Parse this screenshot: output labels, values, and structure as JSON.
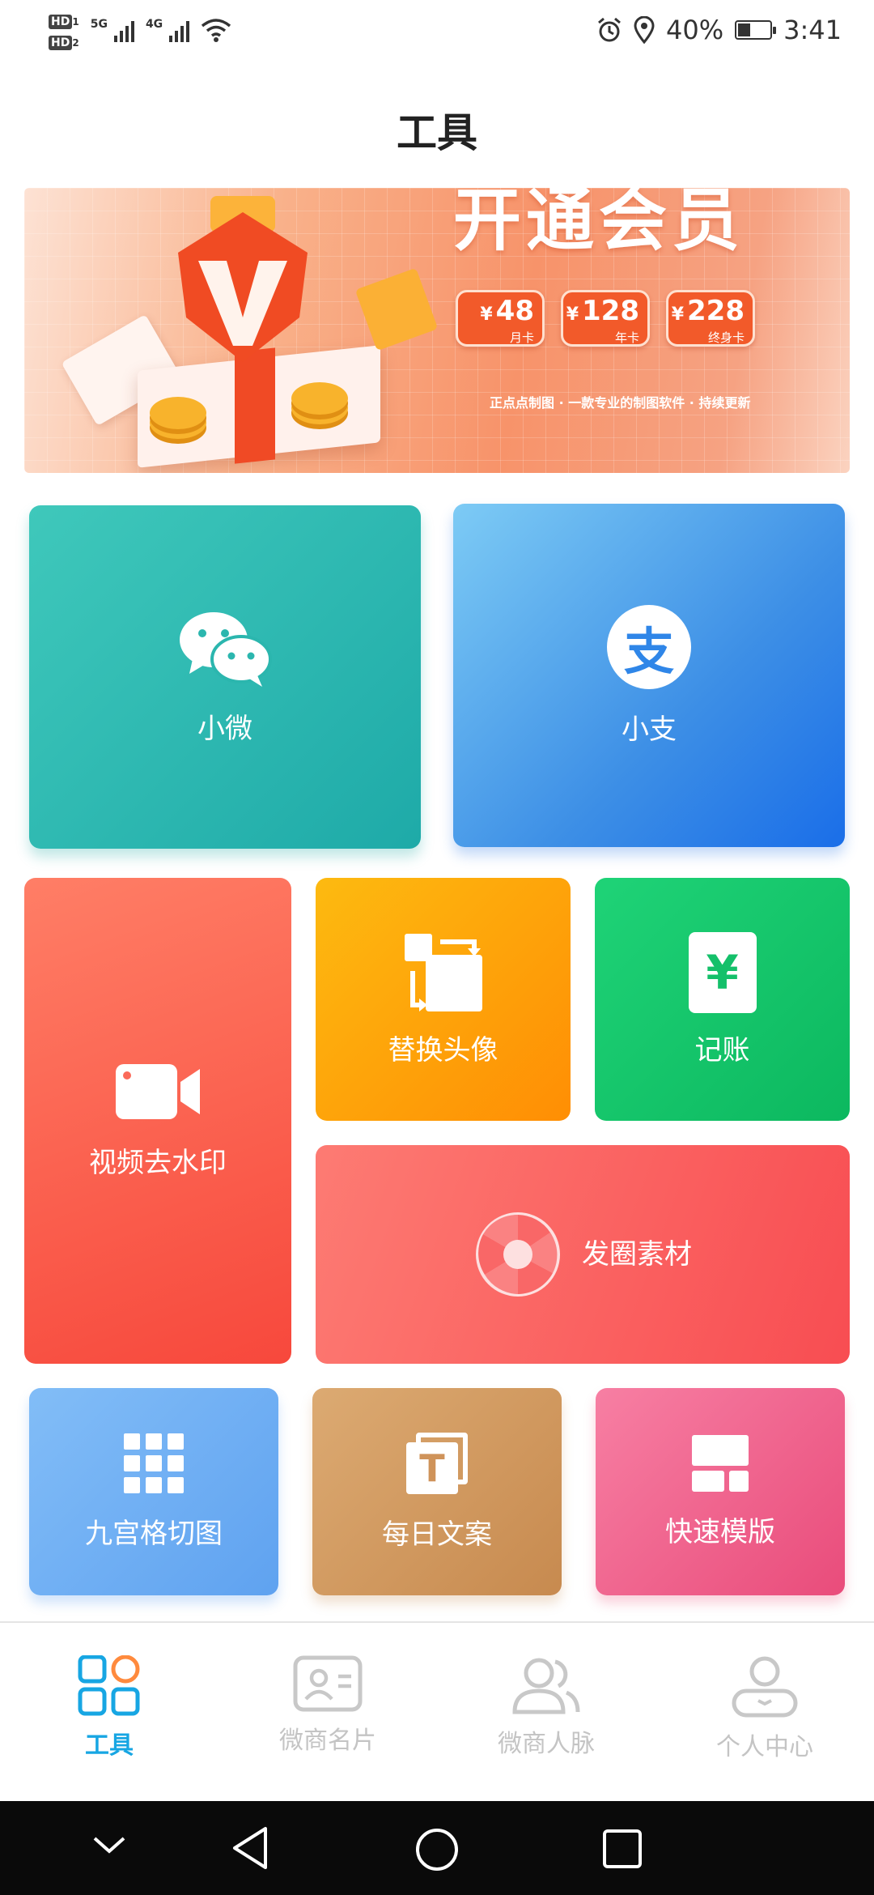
{
  "status_bar": {
    "hd1": "HD",
    "hd1_sub": "1",
    "hd2": "HD",
    "hd2_sub": "2",
    "net1": "5G",
    "net2": "4G",
    "battery": "40%",
    "battery_level": 0.4,
    "time": "3:41"
  },
  "header": {
    "title": "工具"
  },
  "banner": {
    "headline": "开通会员",
    "prices": [
      {
        "amount": "48",
        "currency": "¥",
        "plan": "月卡"
      },
      {
        "amount": "128",
        "currency": "¥",
        "plan": "年卡"
      },
      {
        "amount": "228",
        "currency": "¥",
        "plan": "终身卡"
      }
    ],
    "tagline": "正点点制图 · 一款专业的制图软件 · 持续更新"
  },
  "tools": {
    "wechat": "小微",
    "alipay": "小支",
    "alipay_icon_glyph": "支",
    "video": "视频去水印",
    "avatar": "替换头像",
    "ledger": "记账",
    "ledger_icon_glyph": "¥",
    "moments": "发圈素材",
    "ninegrid": "九宫格切图",
    "daily": "每日文案",
    "daily_icon_glyph": "T",
    "quick": "快速模版"
  },
  "bottom_nav": {
    "items": [
      {
        "label": "工具",
        "active": true
      },
      {
        "label": "微商名片",
        "active": false
      },
      {
        "label": "微商人脉",
        "active": false
      },
      {
        "label": "个人中心",
        "active": false
      }
    ]
  },
  "colors": {
    "accent": "#17a6e3",
    "inactive": "#c4c4c4"
  }
}
